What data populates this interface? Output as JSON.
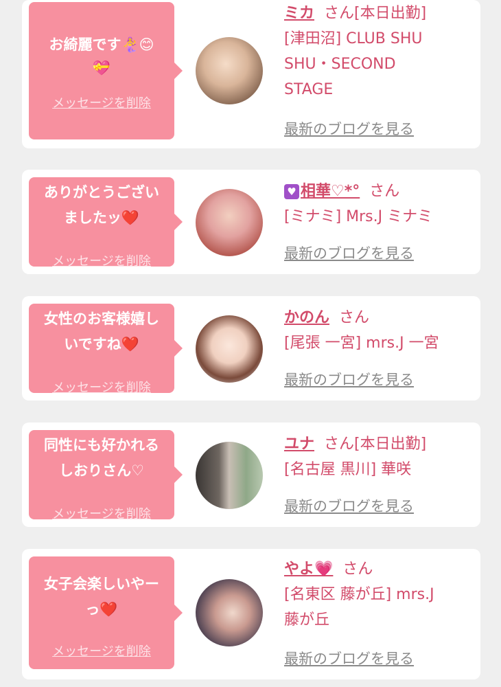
{
  "colors": {
    "accent": "#d24b6a",
    "bubble": "#f7909f",
    "background": "#efefef"
  },
  "delete_label": "メッセージを削除",
  "blog_label": "最新のブログを見る",
  "san_label": "さん",
  "entries": [
    {
      "message_lines": [
        "お綺麗です🧜‍♀️😊",
        "💝"
      ],
      "name": "ミカ",
      "status": "[本日出勤]",
      "shop_lines": [
        "[津田沼] CLUB SHU",
        "SHU・SECOND",
        "STAGE"
      ]
    },
    {
      "message_lines": [
        "ありがとうござい",
        "ましたッ❤️"
      ],
      "name": "相華♡*°",
      "status": "",
      "shop_lines": [
        "[ミナミ] Mrs.J ミナミ"
      ]
    },
    {
      "message_lines": [
        "女性のお客様嬉し",
        "いですね❤️"
      ],
      "name": "かのん",
      "status": "",
      "shop_lines": [
        "[尾張 一宮] mrs.J 一宮"
      ]
    },
    {
      "message_lines": [
        "同性にも好かれる",
        "しおりさん♡"
      ],
      "name": "ユナ",
      "status": "[本日出勤]",
      "shop_lines": [
        "[名古屋 黒川] 華咲"
      ]
    },
    {
      "message_lines": [
        "女子会楽しいやー",
        "っ❤️"
      ],
      "name": "やよ💗",
      "status": "",
      "shop_lines": [
        "[名東区 藤が丘] mrs.J",
        "藤が丘"
      ]
    }
  ]
}
